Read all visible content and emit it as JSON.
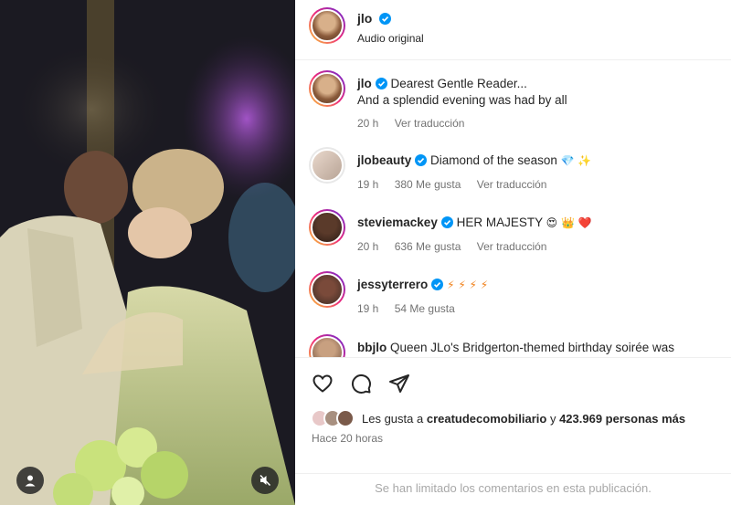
{
  "header": {
    "username": "jlo",
    "subtitle": "Audio original"
  },
  "comments": [
    {
      "username": "jlo",
      "text": "Dearest Gentle Reader...",
      "text2": "And a splendid evening was had by all",
      "time": "20 h",
      "likes": "",
      "translate": "Ver traducción"
    },
    {
      "username": "jlobeauty",
      "text": "Diamond of the season",
      "emoji": "💎 ✨",
      "time": "19 h",
      "likes": "380 Me gusta",
      "translate": "Ver traducción"
    },
    {
      "username": "steviemackey",
      "text": "HER MAJESTY",
      "emoji": "😍 👑 ❤️",
      "time": "20 h",
      "likes": "636 Me gusta",
      "translate": "Ver traducción"
    },
    {
      "username": "jessyterrero",
      "text": "",
      "emoji": "⚡ ⚡ ⚡ ⚡",
      "time": "19 h",
      "likes": "54 Me gusta",
      "translate": ""
    },
    {
      "username": "bbjlo",
      "text": "Queen JLo's Bridgerton-themed birthday soirée was"
    }
  ],
  "likes": {
    "prefix": "Les gusta a",
    "first_user": "creatudecomobiliario",
    "connector": "y",
    "others": "423.969 personas más"
  },
  "posted_time": "Hace 20 horas",
  "comments_limited": "Se han limitado los comentarios en esta publicación.",
  "colors": {
    "verified": "#0095f6",
    "muted_text": "#737373",
    "divider": "#efefef"
  }
}
